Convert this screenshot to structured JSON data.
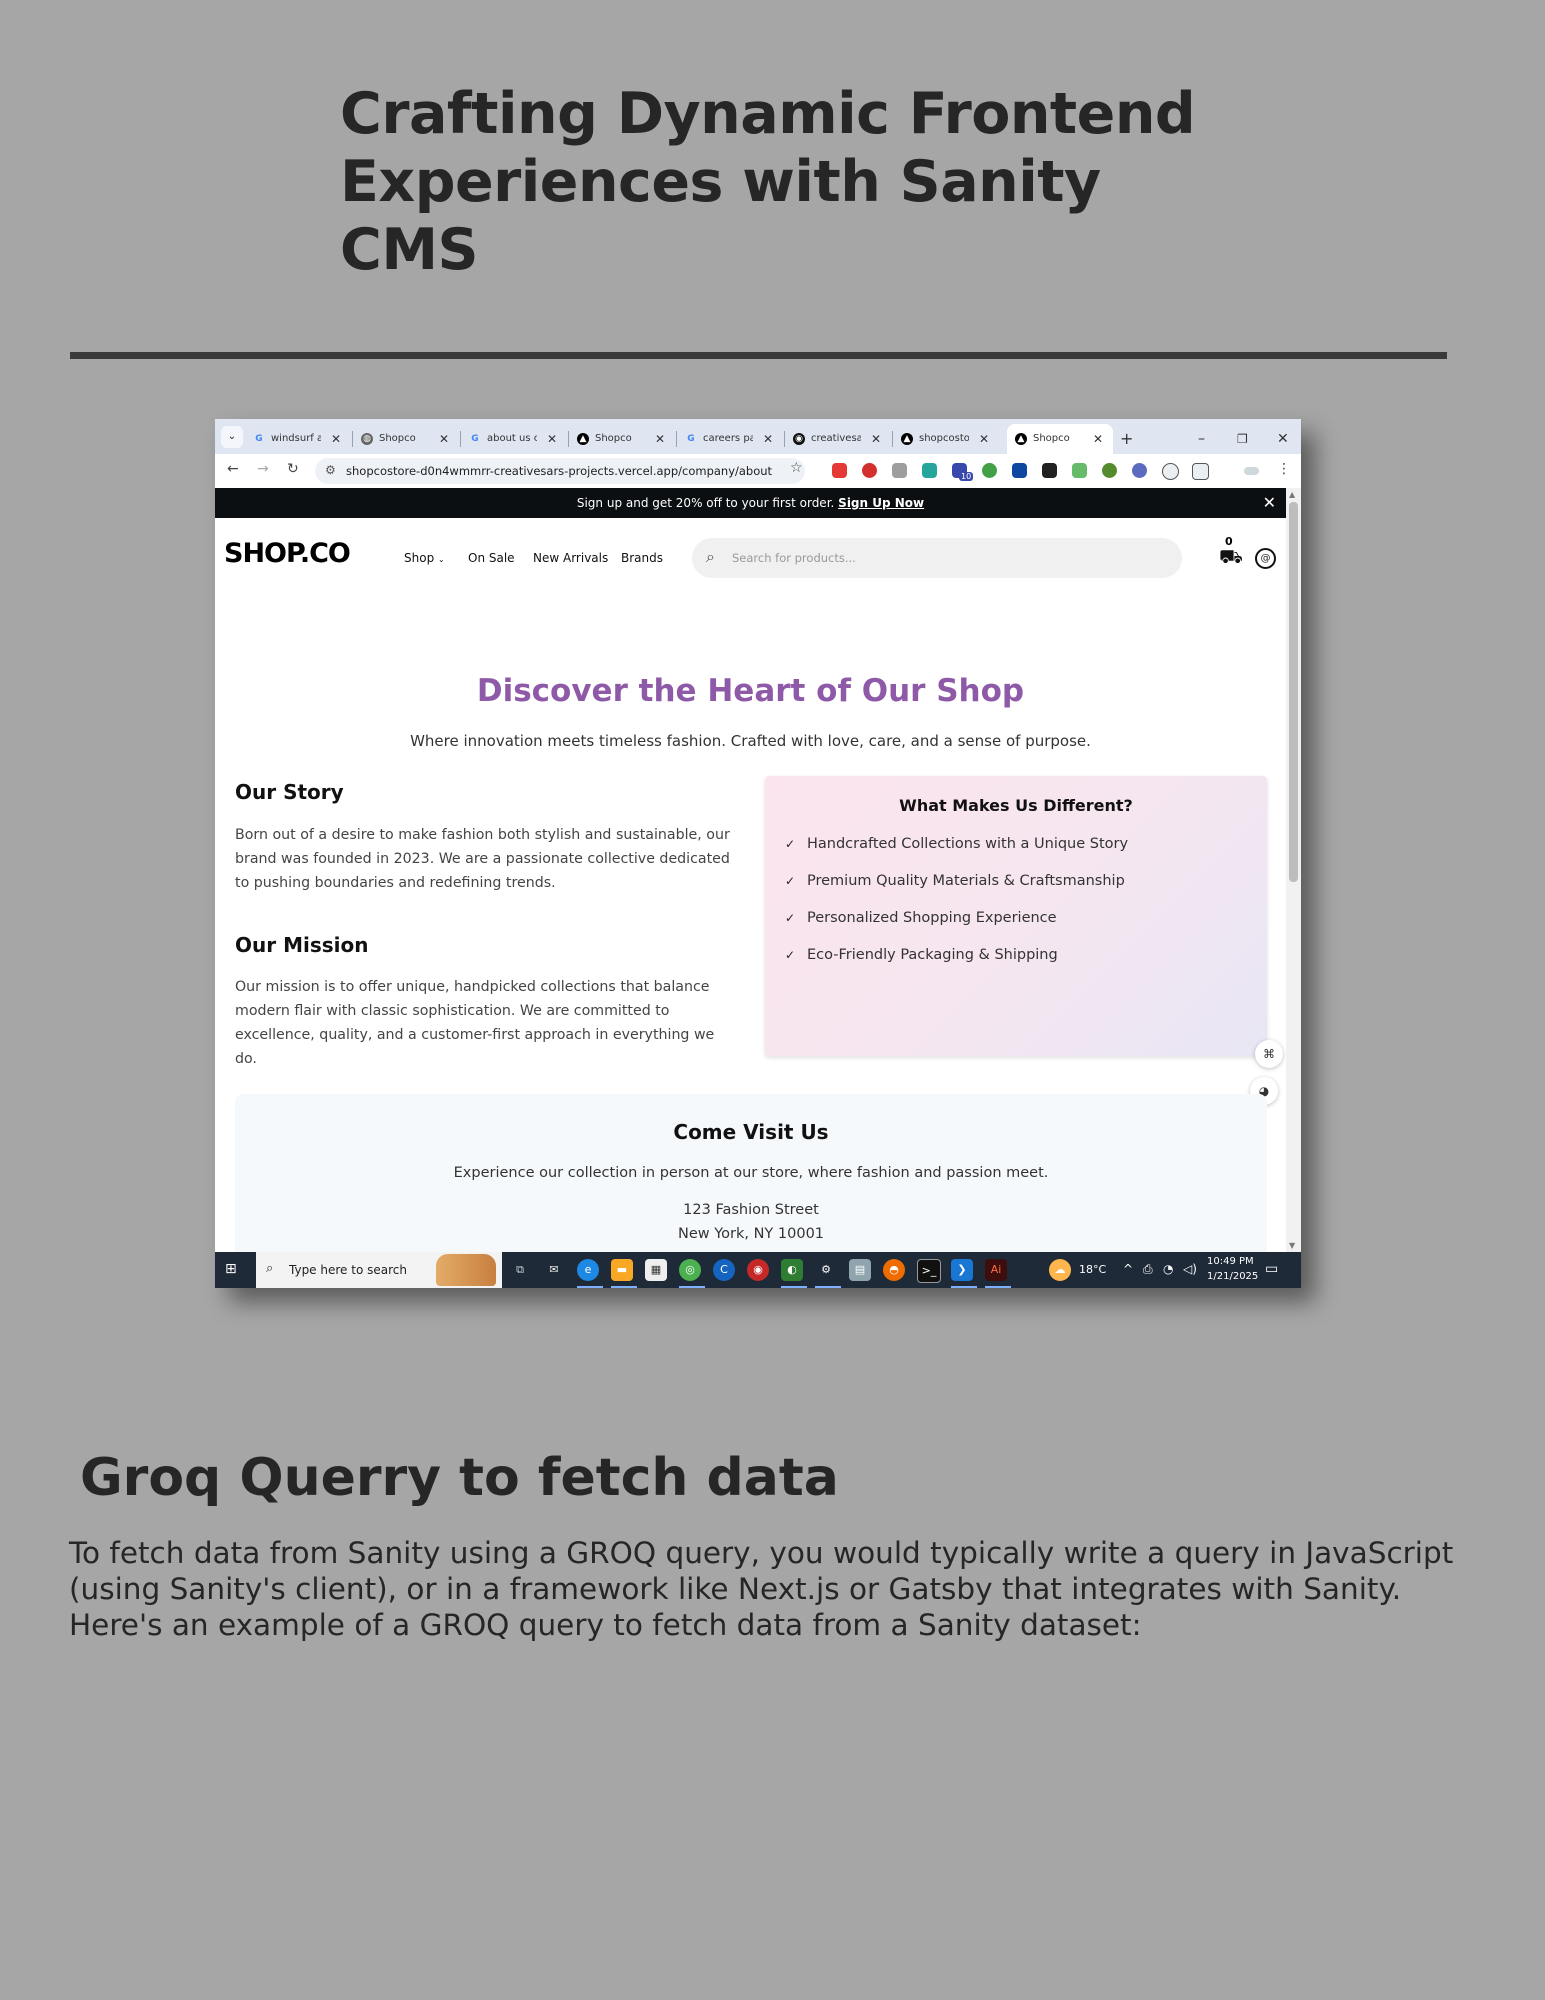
{
  "document": {
    "title": "Crafting Dynamic Frontend\nExperiences with Sanity CMS",
    "section_title": "Groq Querry to fetch data",
    "section_body": "To fetch data from Sanity using a GROQ query, you would typically write a query in JavaScript (using Sanity's client), or in a framework like Next.js or Gatsby that integrates with Sanity. Here's an example of a GROQ query to fetch data from a Sanity dataset:"
  },
  "browser": {
    "tabs": [
      {
        "label": "windsurf a",
        "favicon": "google-icon",
        "active": false
      },
      {
        "label": "Shopco",
        "favicon": "globe-icon",
        "active": false
      },
      {
        "label": "about us c",
        "favicon": "google-icon",
        "active": false
      },
      {
        "label": "Shopco",
        "favicon": "vercel-icon",
        "active": false
      },
      {
        "label": "careers pa",
        "favicon": "google-icon",
        "active": false
      },
      {
        "label": "creativesa",
        "favicon": "github-icon",
        "active": false
      },
      {
        "label": "shopcosto",
        "favicon": "vercel-icon",
        "active": false
      },
      {
        "label": "Shopco",
        "favicon": "vercel-icon",
        "active": true
      }
    ],
    "url": "shopcostore-d0n4wmmrr-creativesars-projects.vercel.app/company/about",
    "extension_badge": "10"
  },
  "site": {
    "promo_text": "Sign up and get 20% off to your first order.",
    "promo_link": "Sign Up Now",
    "logo": "SHOP.CO",
    "nav": [
      "Shop",
      "On Sale",
      "New Arrivals",
      "Brands"
    ],
    "search_placeholder": "Search for products...",
    "cart_count": "0",
    "hero_title": "Discover the Heart of Our Shop",
    "hero_subtitle": "Where innovation meets timeless fashion. Crafted with love, care, and a sense of purpose.",
    "story_title": "Our Story",
    "story_text": "Born out of a desire to make fashion both stylish and sustainable, our brand was founded in 2023. We are a passionate collective dedicated to pushing boundaries and redefining trends.",
    "mission_title": "Our Mission",
    "mission_text": "Our mission is to offer unique, handpicked collections that balance modern flair with classic sophistication. We are committed to excellence, quality, and a customer-first approach in everything we do.",
    "different_title": "What Makes Us Different?",
    "different_items": [
      "Handcrafted Collections with a Unique Story",
      "Premium Quality Materials & Craftsmanship",
      "Personalized Shopping Experience",
      "Eco-Friendly Packaging & Shipping"
    ],
    "visit_title": "Come Visit Us",
    "visit_subtitle": "Experience our collection in person at our store, where fashion and passion meet.",
    "visit_address_line1": "123 Fashion Street",
    "visit_address_line2": "New York, NY 10001"
  },
  "taskbar": {
    "search_placeholder": "Type here to search",
    "weather": "18°C",
    "time": "10:49 PM",
    "date": "1/21/2025"
  },
  "colors": {
    "hero_title": "#8e5aa8",
    "promo_bg": "#0b0f12",
    "taskbar_bg": "#1f2a38",
    "page_bg": "#a6a6a6"
  }
}
